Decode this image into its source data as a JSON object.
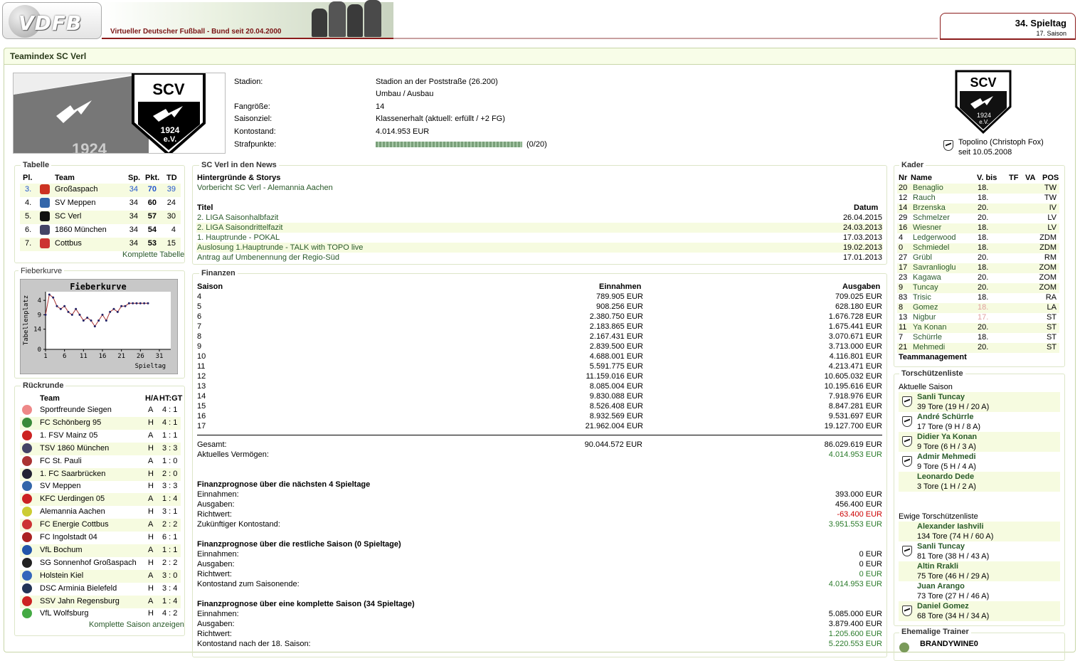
{
  "header": {
    "logo": "VDFB",
    "banner": "Virtueller Deutscher Fußball - Bund seit 20.04.2000",
    "matchday": "34. Spieltag",
    "season": "17. Saison"
  },
  "page_title": "Teamindex SC Verl",
  "club_info": {
    "rows": [
      {
        "label": "Stadion:",
        "value": "Stadion an der Poststraße (26.200)"
      },
      {
        "label": "",
        "value": "Umbau / Ausbau"
      },
      {
        "label": "Fangröße:",
        "value": "14"
      },
      {
        "label": "Saisonziel:",
        "value": "Klassenerhalt (aktuell: erfüllt / +2 FG)"
      },
      {
        "label": "Kontostand:",
        "value": "4.014.953 EUR"
      },
      {
        "label": "Strafpunkte:",
        "value": "(0/20)"
      }
    ],
    "banner_year": "1924",
    "crest_text": "SCV",
    "crest_year": "1924",
    "crest_ev": "e.V.",
    "manager": "Topolino (Christoph Fox)",
    "manager_since": "seit 10.05.2008"
  },
  "tabelle": {
    "title": "Tabelle",
    "headers": [
      "Pl.",
      "Team",
      "Sp.",
      "Pkt.",
      "TD"
    ],
    "rows": [
      {
        "pl": "3.",
        "team": "Großaspach",
        "sp": "34",
        "pkt": "70",
        "td": "39"
      },
      {
        "pl": "4.",
        "team": "SV Meppen",
        "sp": "34",
        "pkt": "60",
        "td": "24"
      },
      {
        "pl": "5.",
        "team": "SC Verl",
        "sp": "34",
        "pkt": "57",
        "td": "30"
      },
      {
        "pl": "6.",
        "team": "1860 München",
        "sp": "34",
        "pkt": "54",
        "td": "4"
      },
      {
        "pl": "7.",
        "team": "Cottbus",
        "sp": "34",
        "pkt": "53",
        "td": "15"
      }
    ],
    "link": "Komplette Tabelle"
  },
  "fieberkurve": {
    "title": "Fieberkurve",
    "chart_title": "Fieberkurve",
    "ylabel": "Tabellenplatz",
    "xlabel": "Spieltag"
  },
  "chart_data": {
    "type": "line",
    "title": "Fieberkurve",
    "xlabel": "Spieltag",
    "ylabel": "Tabellenplatz",
    "x": [
      1,
      2,
      3,
      4,
      5,
      6,
      7,
      8,
      9,
      10,
      11,
      12,
      13,
      14,
      15,
      16,
      17,
      18,
      19,
      20,
      21,
      22,
      23,
      24,
      25,
      26,
      27,
      28
    ],
    "values": [
      9,
      2,
      3,
      6,
      7,
      6,
      8,
      9,
      7,
      9,
      11,
      10,
      11,
      13,
      11,
      9,
      11,
      8,
      7,
      8,
      6,
      6,
      5,
      5,
      5,
      5,
      5,
      5
    ],
    "y_ticks": [
      4,
      9,
      14,
      0
    ],
    "x_ticks": [
      1,
      6,
      11,
      16,
      21,
      26,
      31
    ],
    "ylim": [
      0,
      21
    ],
    "xlim": [
      1,
      34
    ],
    "y_inverted": true
  },
  "rueckrunde": {
    "title": "Rückrunde",
    "headers": [
      "Team",
      "H/A",
      "HT:GT"
    ],
    "rows": [
      {
        "team": "Sportfreunde Siegen",
        "ha": "A",
        "res": "4 : 1",
        "c": "#e88"
      },
      {
        "team": "FC Schönberg 95",
        "ha": "H",
        "res": "4 : 1",
        "c": "#3a8a3a"
      },
      {
        "team": "1. FSV Mainz 05",
        "ha": "A",
        "res": "1 : 1",
        "c": "#c22"
      },
      {
        "team": "TSV 1860 München",
        "ha": "H",
        "res": "3 : 3",
        "c": "#446"
      },
      {
        "team": "FC St. Pauli",
        "ha": "A",
        "res": "1 : 0",
        "c": "#a33"
      },
      {
        "team": "1. FC Saarbrücken",
        "ha": "H",
        "res": "2 : 0",
        "c": "#223"
      },
      {
        "team": "SV Meppen",
        "ha": "H",
        "res": "3 : 3",
        "c": "#36a"
      },
      {
        "team": "KFC Uerdingen 05",
        "ha": "A",
        "res": "1 : 4",
        "c": "#c22"
      },
      {
        "team": "Alemannia Aachen",
        "ha": "H",
        "res": "3 : 1",
        "c": "#cc3"
      },
      {
        "team": "FC Energie Cottbus",
        "ha": "A",
        "res": "2 : 2",
        "c": "#c33"
      },
      {
        "team": "FC Ingolstadt 04",
        "ha": "H",
        "res": "6 : 1",
        "c": "#a22"
      },
      {
        "team": "VfL Bochum",
        "ha": "A",
        "res": "1 : 1",
        "c": "#25a"
      },
      {
        "team": "SG Sonnenhof Großaspach",
        "ha": "H",
        "res": "2 : 2",
        "c": "#222"
      },
      {
        "team": "Holstein Kiel",
        "ha": "A",
        "res": "3 : 0",
        "c": "#36b"
      },
      {
        "team": "DSC Arminia Bielefeld",
        "ha": "H",
        "res": "3 : 4",
        "c": "#235"
      },
      {
        "team": "SSV Jahn Regensburg",
        "ha": "A",
        "res": "1 : 4",
        "c": "#c22"
      },
      {
        "team": "VfL Wolfsburg",
        "ha": "H",
        "res": "4 : 2",
        "c": "#4a4"
      }
    ],
    "link": "Komplette Saison anzeigen"
  },
  "news": {
    "title": "SC Verl in den News",
    "story_head": "Hintergründe & Storys",
    "story": "Vorbericht SC Verl - Alemannia Aachen",
    "col_title": "Titel",
    "col_date": "Datum",
    "rows": [
      {
        "t": "2. LIGA Saisonhalbfazit",
        "d": "26.04.2015"
      },
      {
        "t": "2. LIGA Saisondrittelfazit",
        "d": "24.03.2013"
      },
      {
        "t": "1. Hauptrunde - POKAL",
        "d": "17.03.2013"
      },
      {
        "t": "Auslosung 1.Hauptrunde - TALK with TOPO live",
        "d": "19.02.2013"
      },
      {
        "t": "Antrag auf Umbenennung der Regio-Süd",
        "d": "17.01.2013"
      }
    ]
  },
  "finanzen": {
    "title": "Finanzen",
    "headers": [
      "Saison",
      "Einnahmen",
      "Ausgaben"
    ],
    "rows": [
      {
        "s": "4",
        "e": "789.905 EUR",
        "a": "709.025 EUR"
      },
      {
        "s": "5",
        "e": "908.256 EUR",
        "a": "628.180 EUR"
      },
      {
        "s": "6",
        "e": "2.380.750 EUR",
        "a": "1.676.728 EUR"
      },
      {
        "s": "7",
        "e": "2.183.865 EUR",
        "a": "1.675.441 EUR"
      },
      {
        "s": "8",
        "e": "2.167.431 EUR",
        "a": "3.070.671 EUR"
      },
      {
        "s": "9",
        "e": "2.839.500 EUR",
        "a": "3.713.000 EUR"
      },
      {
        "s": "10",
        "e": "4.688.001 EUR",
        "a": "4.116.801 EUR"
      },
      {
        "s": "11",
        "e": "5.591.775 EUR",
        "a": "4.213.471 EUR"
      },
      {
        "s": "12",
        "e": "11.159.016 EUR",
        "a": "10.605.032 EUR"
      },
      {
        "s": "13",
        "e": "8.085.004 EUR",
        "a": "10.195.616 EUR"
      },
      {
        "s": "14",
        "e": "9.830.088 EUR",
        "a": "7.918.976 EUR"
      },
      {
        "s": "15",
        "e": "8.526.408 EUR",
        "a": "8.847.281 EUR"
      },
      {
        "s": "16",
        "e": "8.932.569 EUR",
        "a": "9.531.697 EUR"
      },
      {
        "s": "17",
        "e": "21.962.004 EUR",
        "a": "19.127.700 EUR"
      }
    ],
    "gesamt_label": "Gesamt:",
    "gesamt_e": "90.044.572 EUR",
    "gesamt_a": "86.029.619 EUR",
    "verm_label": "Aktuelles Vermögen:",
    "verm": "4.014.953 EUR",
    "p1": {
      "title": "Finanzprognose über die nächsten 4 Spieltage",
      "rows": [
        {
          "l": "Einnahmen:",
          "v": "393.000 EUR",
          "c": ""
        },
        {
          "l": "Ausgaben:",
          "v": "456.400 EUR",
          "c": ""
        },
        {
          "l": "Richtwert:",
          "v": "-63.400 EUR",
          "c": "red"
        },
        {
          "l": "Zukünftiger Kontostand:",
          "v": "3.951.553 EUR",
          "c": "green"
        }
      ]
    },
    "p2": {
      "title": "Finanzprognose über die restliche Saison (0 Spieltage)",
      "rows": [
        {
          "l": "Einnahmen:",
          "v": "0 EUR",
          "c": ""
        },
        {
          "l": "Ausgaben:",
          "v": "0 EUR",
          "c": ""
        },
        {
          "l": "Richtwert:",
          "v": "0 EUR",
          "c": "green"
        },
        {
          "l": "Kontostand zum Saisonende:",
          "v": "4.014.953 EUR",
          "c": "green"
        }
      ]
    },
    "p3": {
      "title": "Finanzprognose über eine komplette Saison (34 Spieltage)",
      "rows": [
        {
          "l": "Einnahmen:",
          "v": "5.085.000 EUR",
          "c": ""
        },
        {
          "l": "Ausgaben:",
          "v": "3.879.400 EUR",
          "c": ""
        },
        {
          "l": "Richtwert:",
          "v": "1.205.600 EUR",
          "c": "green"
        },
        {
          "l": "Kontostand nach der 18. Saison:",
          "v": "5.220.553 EUR",
          "c": "green"
        }
      ]
    }
  },
  "kader": {
    "title": "Kader",
    "headers": [
      "Nr",
      "Name",
      "V. bis",
      "TF",
      "VA",
      "POS"
    ],
    "rows": [
      {
        "nr": "20",
        "n": "Benaglio",
        "v": "18.",
        "p": "TW",
        "g": false
      },
      {
        "nr": "12",
        "n": "Rauch",
        "v": "18.",
        "p": "TW",
        "g": false
      },
      {
        "nr": "14",
        "n": "Brzenska",
        "v": "20.",
        "p": "IV",
        "g": false
      },
      {
        "nr": "29",
        "n": "Schmelzer",
        "v": "20.",
        "p": "LV",
        "g": false
      },
      {
        "nr": "16",
        "n": "Wiesner",
        "v": "18.",
        "p": "LV",
        "g": false
      },
      {
        "nr": "4",
        "n": "Ledgerwood",
        "v": "18.",
        "p": "ZDM",
        "g": false
      },
      {
        "nr": "0",
        "n": "Schmiedel",
        "v": "18.",
        "p": "ZDM",
        "g": false
      },
      {
        "nr": "27",
        "n": "Grübl",
        "v": "20.",
        "p": "RM",
        "g": false
      },
      {
        "nr": "17",
        "n": "Savranlioglu",
        "v": "18.",
        "p": "ZOM",
        "g": false
      },
      {
        "nr": "23",
        "n": "Kagawa",
        "v": "20.",
        "p": "ZOM",
        "g": false
      },
      {
        "nr": "9",
        "n": "Tuncay",
        "v": "20.",
        "p": "ZOM",
        "g": false
      },
      {
        "nr": "83",
        "n": "Trisic",
        "v": "18.",
        "p": "RA",
        "g": false
      },
      {
        "nr": "8",
        "n": "Gomez",
        "v": "18.",
        "p": "LA",
        "g": true
      },
      {
        "nr": "13",
        "n": "Nigbur",
        "v": "17.",
        "p": "ST",
        "g": true
      },
      {
        "nr": "11",
        "n": "Ya Konan",
        "v": "20.",
        "p": "ST",
        "g": false
      },
      {
        "nr": "7",
        "n": "Schürrle",
        "v": "18.",
        "p": "ST",
        "g": false
      },
      {
        "nr": "21",
        "n": "Mehmedi",
        "v": "20.",
        "p": "ST",
        "g": false
      }
    ],
    "teammanagement": "Teammanagement"
  },
  "torschuetzen": {
    "title": "Torschützenliste",
    "aktuell": "Aktuelle Saison",
    "current": [
      {
        "n": "Sanli Tuncay",
        "t": "39 Tore (19 H / 20 A)",
        "b": true
      },
      {
        "n": "André Schürrle",
        "t": "17 Tore (9 H / 8 A)",
        "b": true
      },
      {
        "n": "Didier Ya Konan",
        "t": "9 Tore (6 H / 3 A)",
        "b": true
      },
      {
        "n": "Admir Mehmedi",
        "t": "9 Tore (5 H / 4 A)",
        "b": true
      },
      {
        "n": "Leonardo Dede",
        "t": "3 Tore (1 H / 2 A)",
        "b": false
      }
    ],
    "ewige": "Ewige Torschützenliste",
    "alltime": [
      {
        "n": "Alexander Iashvili",
        "t": "134 Tore (74 H / 60 A)",
        "b": false
      },
      {
        "n": "Sanli Tuncay",
        "t": "81 Tore (38 H / 43 A)",
        "b": true
      },
      {
        "n": "Altin Rrakli",
        "t": "75 Tore (46 H / 29 A)",
        "b": false
      },
      {
        "n": "Juan Arango",
        "t": "73 Tore (27 H / 46 A)",
        "b": false
      },
      {
        "n": "Daniel Gomez",
        "t": "68 Tore (34 H / 34 A)",
        "b": true
      }
    ]
  },
  "trainer": {
    "title": "Ehemalige Trainer",
    "first": "BRANDYWINE0"
  },
  "colors": {
    "accent": "#8b1b1b",
    "row_alt": "#f6fbe0",
    "positive": "#2a7a2a",
    "negative": "#cc0000",
    "link": "#2255cc"
  }
}
